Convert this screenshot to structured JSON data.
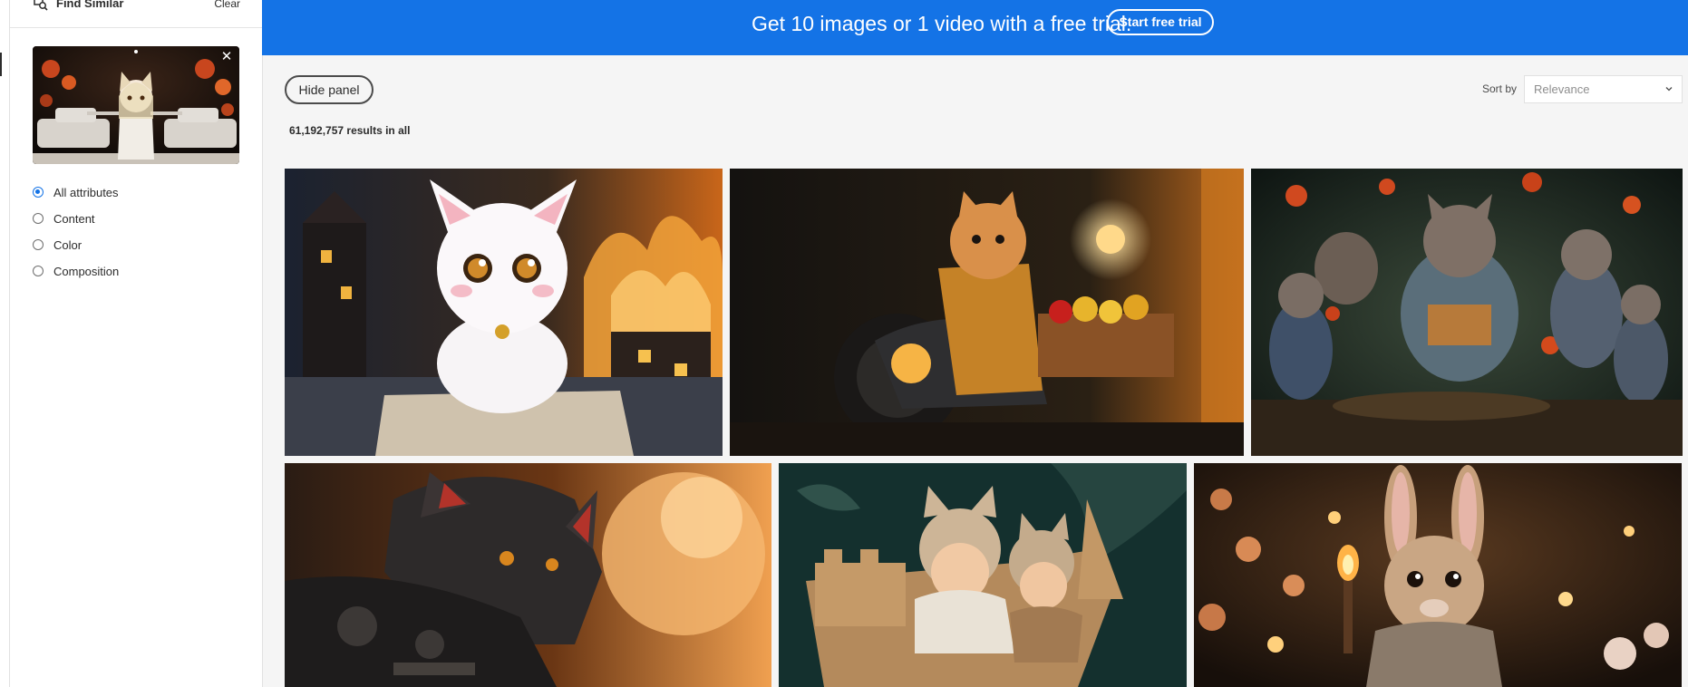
{
  "panel": {
    "title": "Find Similar",
    "clear_label": "Clear",
    "filters": [
      {
        "label": "All attributes",
        "checked": true
      },
      {
        "label": "Content",
        "checked": false
      },
      {
        "label": "Color",
        "checked": false
      },
      {
        "label": "Composition",
        "checked": false
      }
    ]
  },
  "banner": {
    "text": "Get 10 images or 1 video with a free trial.",
    "cta_label": "Start free trial",
    "color": "#1473e6"
  },
  "toolbar": {
    "hide_panel_label": "Hide panel",
    "sort_label": "Sort by",
    "sort_value": "Relevance",
    "results_text": "61,192,757 results in all"
  },
  "images": [
    {
      "subject": "cartoon white cat sitting among burning houses at night"
    },
    {
      "subject": "orange cat in a jacket riding a motorcycle with a fruit crate"
    },
    {
      "subject": "group of woodland animals reading a book in a forest"
    },
    {
      "subject": "armored black panther warrior in front of fire"
    },
    {
      "subject": "children in cat costumes in a cardboard boat"
    },
    {
      "subject": "rabbit holding a torch among flowers at night"
    }
  ],
  "accent_color": "#1473e6"
}
